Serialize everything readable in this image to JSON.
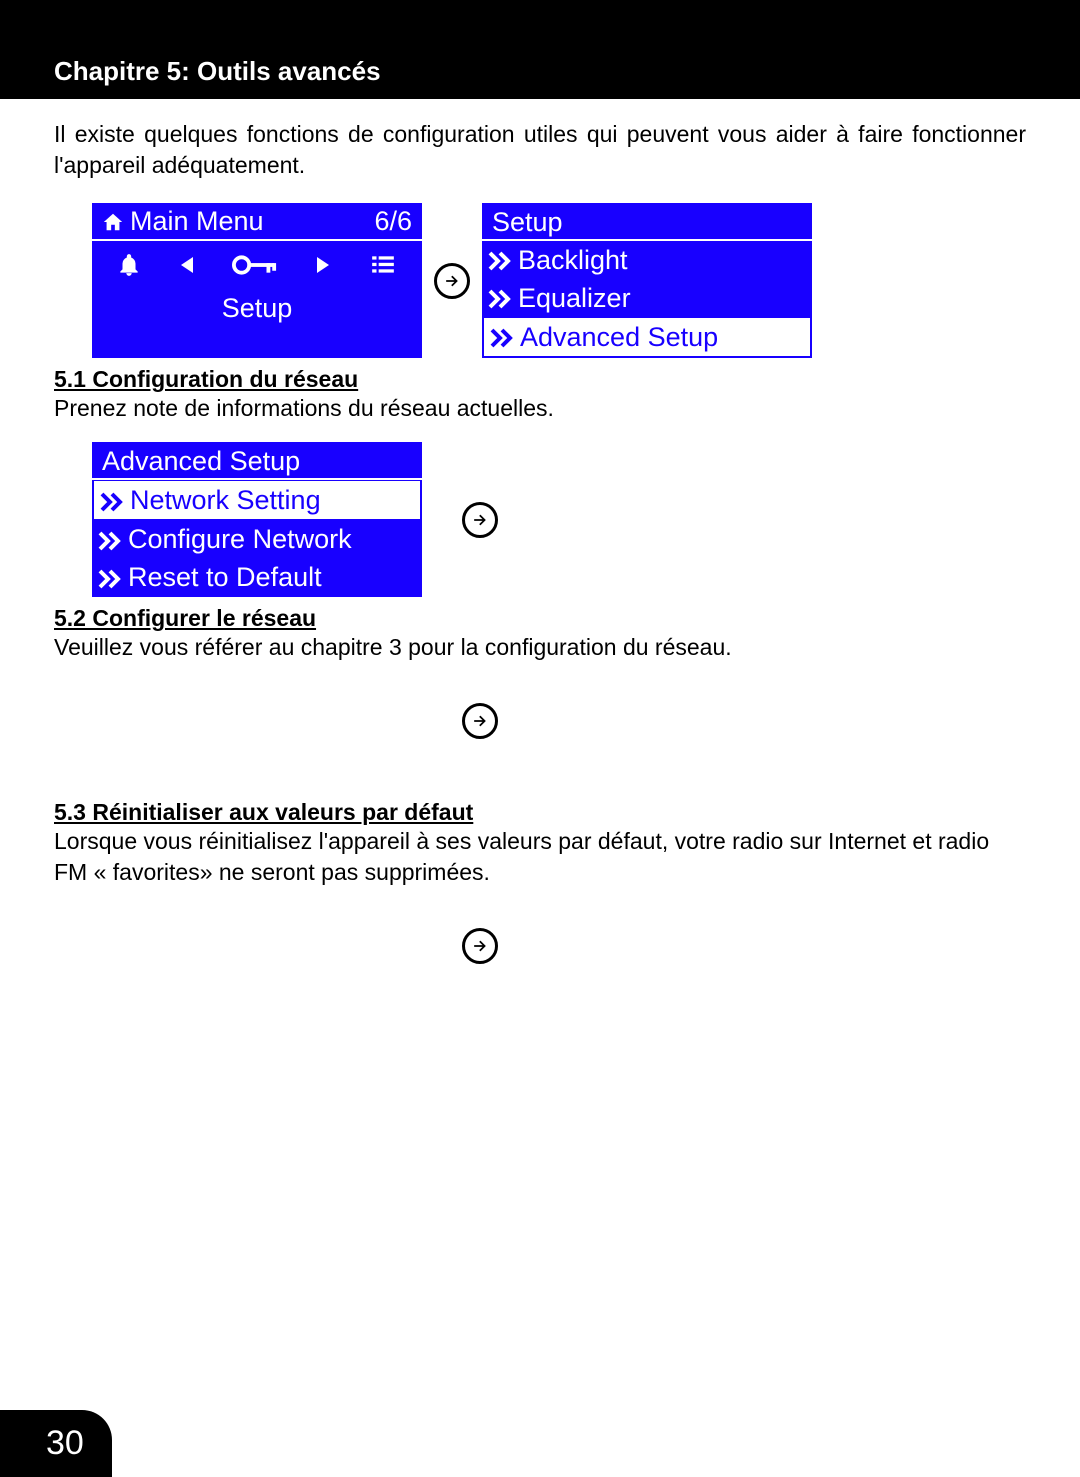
{
  "chapter_title": "Chapitre 5: Outils avancés",
  "intro": "Il existe quelques fonctions de configuration utiles qui peuvent vous aider à faire fonctionner l'appareil adéquatement.",
  "main_menu": {
    "title": "Main Menu",
    "counter": "6/6",
    "selected_label": "Setup"
  },
  "setup_menu": {
    "title": "Setup",
    "items": [
      "Backlight",
      "Equalizer",
      "Advanced Setup"
    ],
    "selected_index": 2
  },
  "section_5_1": {
    "heading": "5.1 Configuration du réseau",
    "text": "Prenez note de informations du réseau actuelles."
  },
  "advanced_menu": {
    "title": "Advanced Setup",
    "items": [
      "Network Setting",
      "Configure Network",
      "Reset to Default"
    ],
    "selected_index": 0
  },
  "section_5_2": {
    "heading": "5.2 Configurer le réseau",
    "text": "Veuillez vous référer au chapitre 3 pour la configuration du réseau."
  },
  "section_5_3": {
    "heading": "5.3 Réinitialiser aux valeurs par défaut",
    "text": "Lorsque vous réinitialisez l'appareil à ses valeurs par défaut, votre radio sur Internet et radio FM « favorites» ne seront pas supprimées."
  },
  "page_number": "30"
}
